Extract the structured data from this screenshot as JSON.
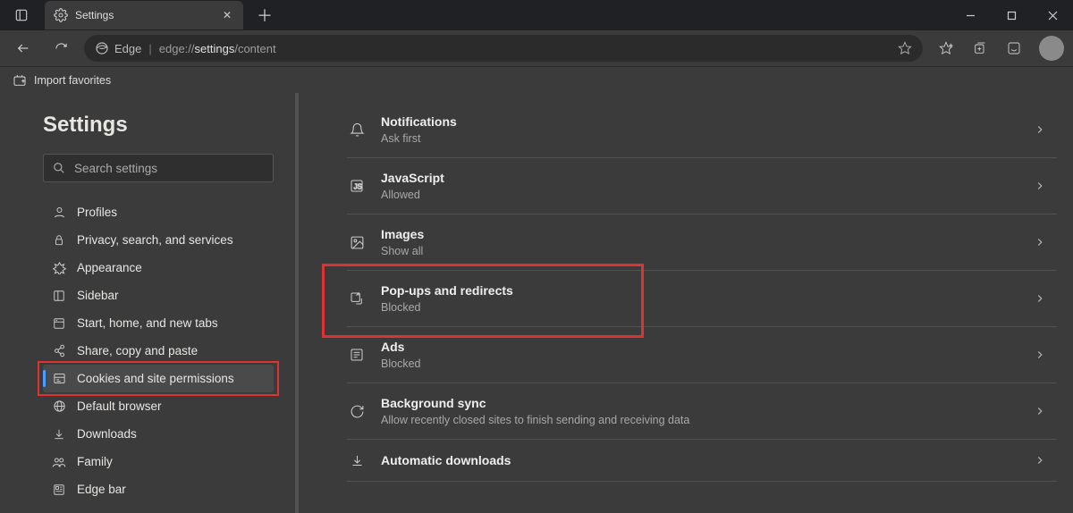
{
  "tab": {
    "title": "Settings"
  },
  "url": {
    "brand": "Edge",
    "prefix": "edge://",
    "mid": "settings",
    "suffix": "/content"
  },
  "favbar": {
    "import": "Import favorites"
  },
  "sidebar": {
    "heading": "Settings",
    "search_placeholder": "Search settings",
    "items": [
      {
        "label": "Profiles"
      },
      {
        "label": "Privacy, search, and services"
      },
      {
        "label": "Appearance"
      },
      {
        "label": "Sidebar"
      },
      {
        "label": "Start, home, and new tabs"
      },
      {
        "label": "Share, copy and paste"
      },
      {
        "label": "Cookies and site permissions"
      },
      {
        "label": "Default browser"
      },
      {
        "label": "Downloads"
      },
      {
        "label": "Family"
      },
      {
        "label": "Edge bar"
      }
    ],
    "active_index": 6
  },
  "permissions": [
    {
      "title": "Notifications",
      "sub": "Ask first"
    },
    {
      "title": "JavaScript",
      "sub": "Allowed"
    },
    {
      "title": "Images",
      "sub": "Show all"
    },
    {
      "title": "Pop-ups and redirects",
      "sub": "Blocked"
    },
    {
      "title": "Ads",
      "sub": "Blocked"
    },
    {
      "title": "Background sync",
      "sub": "Allow recently closed sites to finish sending and receiving data"
    },
    {
      "title": "Automatic downloads",
      "sub": ""
    }
  ],
  "highlight": {
    "sidebar_index": 6,
    "main_index": 3
  }
}
